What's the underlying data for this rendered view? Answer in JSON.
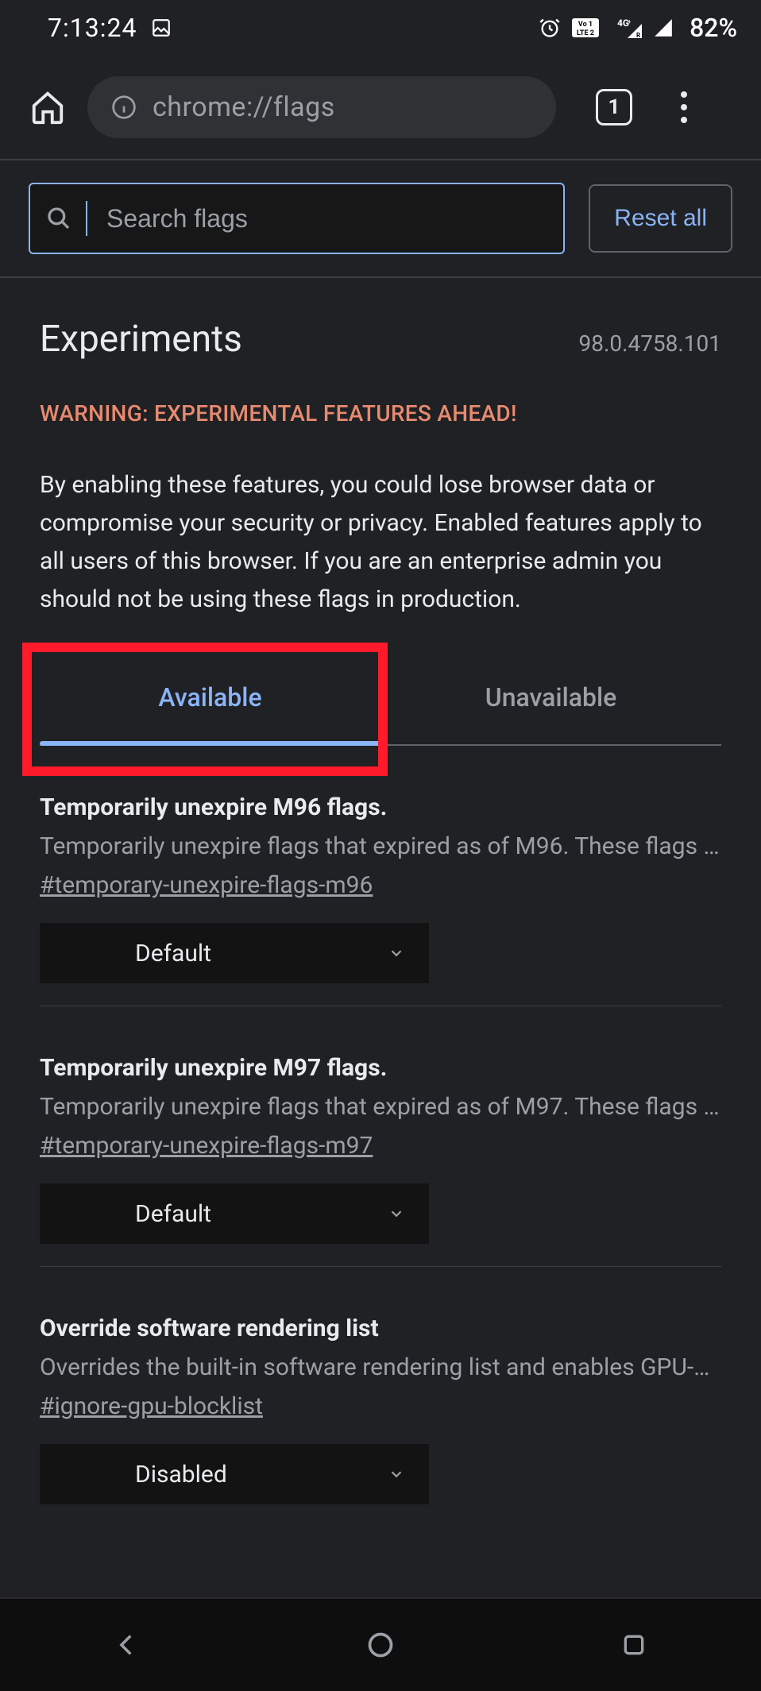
{
  "status": {
    "time": "7:13:24",
    "battery": "82%"
  },
  "browser": {
    "url": "chrome://flags",
    "tab_count": "1"
  },
  "search": {
    "placeholder": "Search flags",
    "reset_label": "Reset all"
  },
  "header": {
    "title": "Experiments",
    "version": "98.0.4758.101"
  },
  "warning": {
    "heading": "WARNING: EXPERIMENTAL FEATURES AHEAD!",
    "body": "By enabling these features, you could lose browser data or compromise your security or privacy. Enabled features apply to all users of this browser. If you are an enterprise admin you should not be using these flags in production."
  },
  "tabs": {
    "available": "Available",
    "unavailable": "Unavailable"
  },
  "flags": [
    {
      "title": "Temporarily unexpire M96 flags.",
      "desc": "Temporarily unexpire flags that expired as of M96. These flags will be removed soon.",
      "anchor": "#temporary-unexpire-flags-m96",
      "value": "Default"
    },
    {
      "title": "Temporarily unexpire M97 flags.",
      "desc": "Temporarily unexpire flags that expired as of M97. These flags will be removed soon.",
      "anchor": "#temporary-unexpire-flags-m97",
      "value": "Default"
    },
    {
      "title": "Override software rendering list",
      "desc": "Overrides the built-in software rendering list and enables GPU-acceleration on unsupported system configurations.",
      "anchor": "#ignore-gpu-blocklist",
      "value": "Disabled"
    }
  ]
}
